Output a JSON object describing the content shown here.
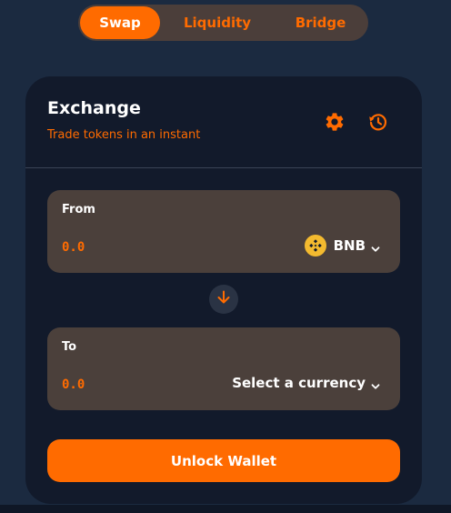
{
  "tabs": [
    {
      "label": "Swap",
      "active": true
    },
    {
      "label": "Liquidity",
      "active": false
    },
    {
      "label": "Bridge",
      "active": false
    }
  ],
  "card": {
    "title": "Exchange",
    "subtitle": "Trade tokens in an instant",
    "icons": [
      "gear-icon",
      "history-icon"
    ]
  },
  "from": {
    "label": "From",
    "amount_placeholder": "0.0",
    "currency": "BNB",
    "currency_icon": "bnb-logo-icon"
  },
  "to": {
    "label": "To",
    "amount_placeholder": "0.0",
    "currency": "Select a currency"
  },
  "swap_icon": "arrow-down-icon",
  "unlock_button": "Unlock Wallet",
  "colors": {
    "accent": "#ff6b00",
    "background": "#1b2a40",
    "card": "#121a2b",
    "panel": "#4b403b",
    "bnb": "#f3ba2f"
  }
}
